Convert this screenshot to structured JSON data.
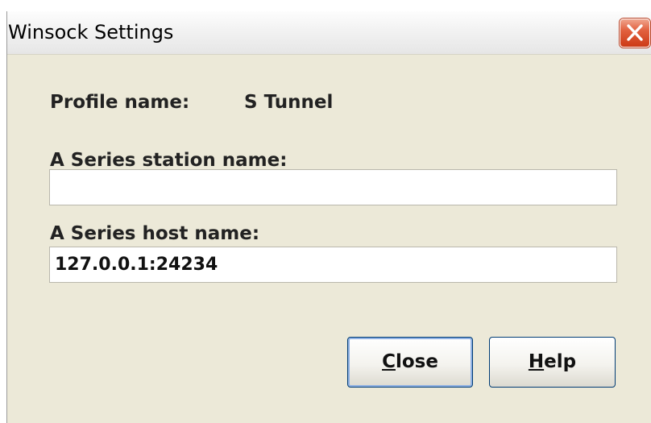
{
  "window": {
    "title": "Winsock Settings"
  },
  "profile": {
    "label": "Profile name:",
    "value": "S Tunnel"
  },
  "station": {
    "label": "A Series station name:",
    "value": ""
  },
  "host": {
    "label": "A Series host name:",
    "value": "127.0.0.1:24234"
  },
  "buttons": {
    "close": {
      "accel": "C",
      "rest": "lose"
    },
    "help": {
      "accel": "H",
      "rest": "elp"
    }
  },
  "icons": {
    "close": "close-icon"
  },
  "colors": {
    "dialog_bg": "#ece9d8",
    "close_button": "#e2613f",
    "button_border": "#003c74"
  }
}
